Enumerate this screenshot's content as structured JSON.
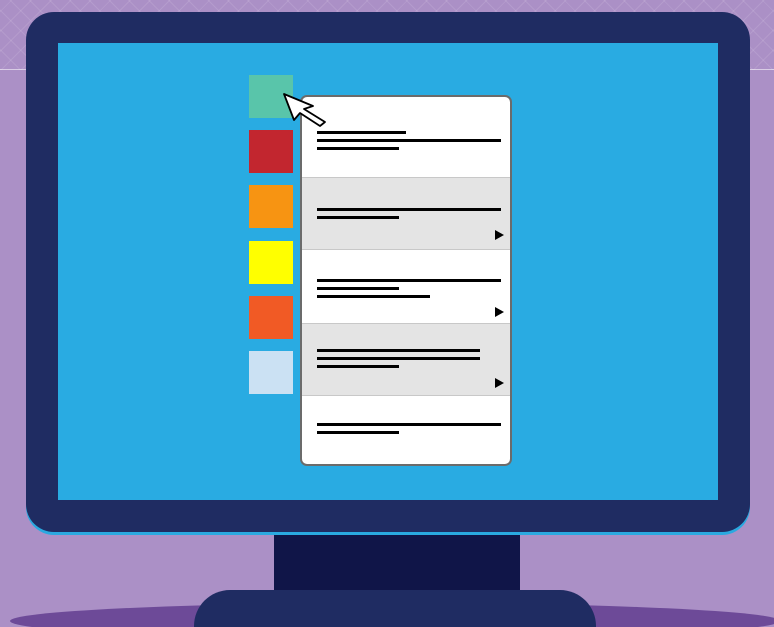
{
  "palette": {
    "background": "#ab90c6",
    "monitor_frame": "#1f2c62",
    "stand_neck": "#101548",
    "screen": "#29abe2",
    "menu_background": "#ffffff",
    "menu_alt_row": "#e4e4e4",
    "menu_border": "#6b6b6b",
    "text_placeholder": "#000000"
  },
  "swatches": [
    {
      "name": "teal",
      "color": "#59c5aa"
    },
    {
      "name": "red",
      "color": "#c2262f"
    },
    {
      "name": "orange",
      "color": "#f79412"
    },
    {
      "name": "yellow",
      "color": "#ffff00"
    },
    {
      "name": "orange-red",
      "color": "#f15a25"
    },
    {
      "name": "light-blue",
      "color": "#cbe1f3"
    }
  ],
  "context_menu": {
    "items": [
      {
        "text_lines": 3,
        "has_submenu": false
      },
      {
        "text_lines": 2,
        "has_submenu": true
      },
      {
        "text_lines": 3,
        "has_submenu": true
      },
      {
        "text_lines": 3,
        "has_submenu": true
      },
      {
        "text_lines": 2,
        "has_submenu": false
      }
    ]
  },
  "icons": {
    "cursor": "mouse-pointer-icon",
    "submenu": "submenu-arrow-icon"
  }
}
